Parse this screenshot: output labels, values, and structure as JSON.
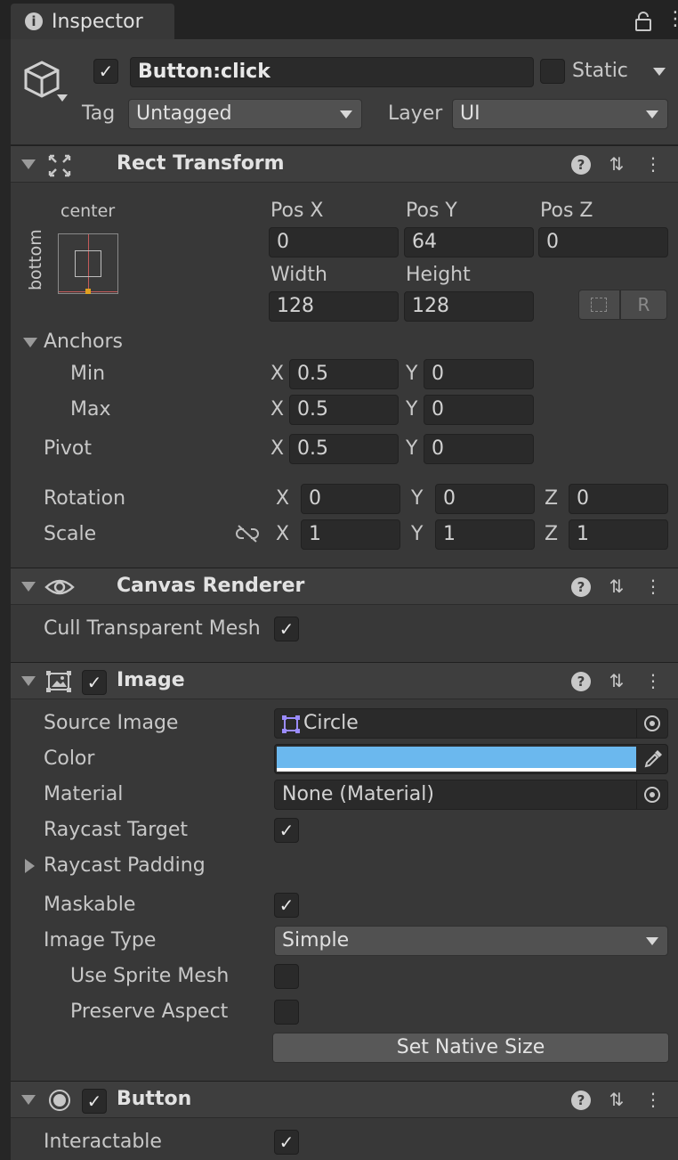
{
  "window": {
    "tab_title": "Inspector"
  },
  "object": {
    "active": true,
    "name": "Button:click",
    "static_label": "Static",
    "static_checked": false,
    "tag_label": "Tag",
    "tag_value": "Untagged",
    "layer_label": "Layer",
    "layer_value": "UI"
  },
  "rect_transform": {
    "title": "Rect Transform",
    "anchor_preset_top": "center",
    "anchor_preset_side": "bottom",
    "pos_x_label": "Pos X",
    "pos_y_label": "Pos Y",
    "pos_z_label": "Pos Z",
    "pos_x": "0",
    "pos_y": "64",
    "pos_z": "0",
    "width_label": "Width",
    "height_label": "Height",
    "width": "128",
    "height": "128",
    "raw_button_label": "R",
    "anchors_label": "Anchors",
    "min_label": "Min",
    "max_label": "Max",
    "min_x": "0.5",
    "min_y": "0",
    "max_x": "0.5",
    "max_y": "0",
    "pivot_label": "Pivot",
    "pivot_x": "0.5",
    "pivot_y": "0",
    "rotation_label": "Rotation",
    "rot_x": "0",
    "rot_y": "0",
    "rot_z": "0",
    "scale_label": "Scale",
    "scale_x": "1",
    "scale_y": "1",
    "scale_z": "1",
    "axis_x": "X",
    "axis_y": "Y",
    "axis_z": "Z"
  },
  "canvas_renderer": {
    "title": "Canvas Renderer",
    "cull_label": "Cull Transparent Mesh",
    "cull_checked": true
  },
  "image": {
    "title": "Image",
    "enabled": true,
    "source_image_label": "Source Image",
    "source_image_value": "Circle",
    "color_label": "Color",
    "color_value": "#6bb8ee",
    "material_label": "Material",
    "material_value": "None (Material)",
    "raycast_target_label": "Raycast Target",
    "raycast_target_checked": true,
    "raycast_padding_label": "Raycast Padding",
    "maskable_label": "Maskable",
    "maskable_checked": true,
    "image_type_label": "Image Type",
    "image_type_value": "Simple",
    "use_sprite_mesh_label": "Use Sprite Mesh",
    "use_sprite_mesh_checked": false,
    "preserve_aspect_label": "Preserve Aspect",
    "preserve_aspect_checked": false,
    "set_native_size_label": "Set Native Size"
  },
  "button": {
    "title": "Button",
    "enabled": true,
    "interactable_label": "Interactable",
    "interactable_checked": true
  },
  "glyphs": {
    "check": "✓",
    "help": "?",
    "presets": "⇅",
    "menu": "⋮"
  },
  "icons": [
    "info-icon",
    "lock-icon",
    "tab-menu-icon",
    "gameobject-cube-icon",
    "rect-transform-icon",
    "eye-icon",
    "image-component-icon",
    "button-component-icon",
    "help-icon",
    "presets-icon",
    "kebab-menu-icon",
    "object-picker-icon",
    "eyedropper-icon",
    "blueprint-mode-icon",
    "constrain-proportions-icon"
  ]
}
